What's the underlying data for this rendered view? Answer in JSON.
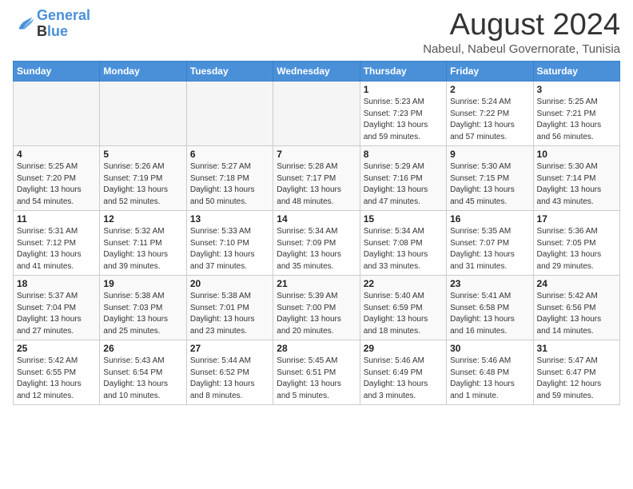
{
  "logo": {
    "line1": "General",
    "line2": "Blue"
  },
  "title": "August 2024",
  "location": "Nabeul, Nabeul Governorate, Tunisia",
  "headers": [
    "Sunday",
    "Monday",
    "Tuesday",
    "Wednesday",
    "Thursday",
    "Friday",
    "Saturday"
  ],
  "weeks": [
    [
      {
        "day": "",
        "detail": ""
      },
      {
        "day": "",
        "detail": ""
      },
      {
        "day": "",
        "detail": ""
      },
      {
        "day": "",
        "detail": ""
      },
      {
        "day": "1",
        "detail": "Sunrise: 5:23 AM\nSunset: 7:23 PM\nDaylight: 13 hours\nand 59 minutes."
      },
      {
        "day": "2",
        "detail": "Sunrise: 5:24 AM\nSunset: 7:22 PM\nDaylight: 13 hours\nand 57 minutes."
      },
      {
        "day": "3",
        "detail": "Sunrise: 5:25 AM\nSunset: 7:21 PM\nDaylight: 13 hours\nand 56 minutes."
      }
    ],
    [
      {
        "day": "4",
        "detail": "Sunrise: 5:25 AM\nSunset: 7:20 PM\nDaylight: 13 hours\nand 54 minutes."
      },
      {
        "day": "5",
        "detail": "Sunrise: 5:26 AM\nSunset: 7:19 PM\nDaylight: 13 hours\nand 52 minutes."
      },
      {
        "day": "6",
        "detail": "Sunrise: 5:27 AM\nSunset: 7:18 PM\nDaylight: 13 hours\nand 50 minutes."
      },
      {
        "day": "7",
        "detail": "Sunrise: 5:28 AM\nSunset: 7:17 PM\nDaylight: 13 hours\nand 48 minutes."
      },
      {
        "day": "8",
        "detail": "Sunrise: 5:29 AM\nSunset: 7:16 PM\nDaylight: 13 hours\nand 47 minutes."
      },
      {
        "day": "9",
        "detail": "Sunrise: 5:30 AM\nSunset: 7:15 PM\nDaylight: 13 hours\nand 45 minutes."
      },
      {
        "day": "10",
        "detail": "Sunrise: 5:30 AM\nSunset: 7:14 PM\nDaylight: 13 hours\nand 43 minutes."
      }
    ],
    [
      {
        "day": "11",
        "detail": "Sunrise: 5:31 AM\nSunset: 7:12 PM\nDaylight: 13 hours\nand 41 minutes."
      },
      {
        "day": "12",
        "detail": "Sunrise: 5:32 AM\nSunset: 7:11 PM\nDaylight: 13 hours\nand 39 minutes."
      },
      {
        "day": "13",
        "detail": "Sunrise: 5:33 AM\nSunset: 7:10 PM\nDaylight: 13 hours\nand 37 minutes."
      },
      {
        "day": "14",
        "detail": "Sunrise: 5:34 AM\nSunset: 7:09 PM\nDaylight: 13 hours\nand 35 minutes."
      },
      {
        "day": "15",
        "detail": "Sunrise: 5:34 AM\nSunset: 7:08 PM\nDaylight: 13 hours\nand 33 minutes."
      },
      {
        "day": "16",
        "detail": "Sunrise: 5:35 AM\nSunset: 7:07 PM\nDaylight: 13 hours\nand 31 minutes."
      },
      {
        "day": "17",
        "detail": "Sunrise: 5:36 AM\nSunset: 7:05 PM\nDaylight: 13 hours\nand 29 minutes."
      }
    ],
    [
      {
        "day": "18",
        "detail": "Sunrise: 5:37 AM\nSunset: 7:04 PM\nDaylight: 13 hours\nand 27 minutes."
      },
      {
        "day": "19",
        "detail": "Sunrise: 5:38 AM\nSunset: 7:03 PM\nDaylight: 13 hours\nand 25 minutes."
      },
      {
        "day": "20",
        "detail": "Sunrise: 5:38 AM\nSunset: 7:01 PM\nDaylight: 13 hours\nand 23 minutes."
      },
      {
        "day": "21",
        "detail": "Sunrise: 5:39 AM\nSunset: 7:00 PM\nDaylight: 13 hours\nand 20 minutes."
      },
      {
        "day": "22",
        "detail": "Sunrise: 5:40 AM\nSunset: 6:59 PM\nDaylight: 13 hours\nand 18 minutes."
      },
      {
        "day": "23",
        "detail": "Sunrise: 5:41 AM\nSunset: 6:58 PM\nDaylight: 13 hours\nand 16 minutes."
      },
      {
        "day": "24",
        "detail": "Sunrise: 5:42 AM\nSunset: 6:56 PM\nDaylight: 13 hours\nand 14 minutes."
      }
    ],
    [
      {
        "day": "25",
        "detail": "Sunrise: 5:42 AM\nSunset: 6:55 PM\nDaylight: 13 hours\nand 12 minutes."
      },
      {
        "day": "26",
        "detail": "Sunrise: 5:43 AM\nSunset: 6:54 PM\nDaylight: 13 hours\nand 10 minutes."
      },
      {
        "day": "27",
        "detail": "Sunrise: 5:44 AM\nSunset: 6:52 PM\nDaylight: 13 hours\nand 8 minutes."
      },
      {
        "day": "28",
        "detail": "Sunrise: 5:45 AM\nSunset: 6:51 PM\nDaylight: 13 hours\nand 5 minutes."
      },
      {
        "day": "29",
        "detail": "Sunrise: 5:46 AM\nSunset: 6:49 PM\nDaylight: 13 hours\nand 3 minutes."
      },
      {
        "day": "30",
        "detail": "Sunrise: 5:46 AM\nSunset: 6:48 PM\nDaylight: 13 hours\nand 1 minute."
      },
      {
        "day": "31",
        "detail": "Sunrise: 5:47 AM\nSunset: 6:47 PM\nDaylight: 12 hours\nand 59 minutes."
      }
    ]
  ]
}
